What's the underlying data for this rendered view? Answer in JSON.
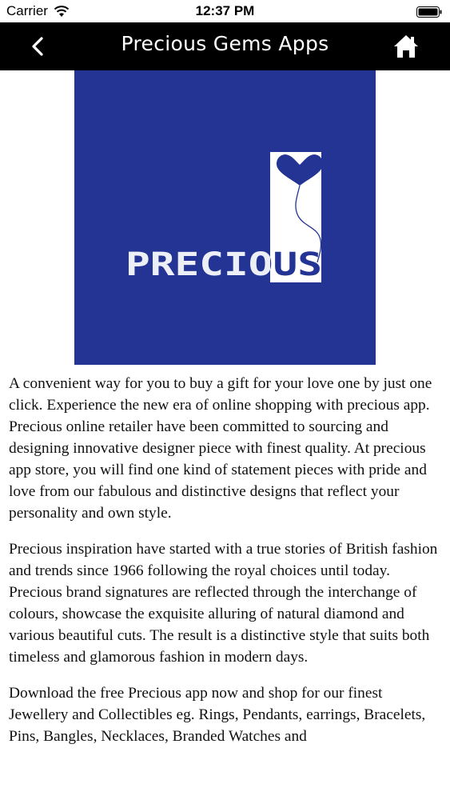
{
  "status_bar": {
    "carrier": "Carrier",
    "time": "12:37 PM"
  },
  "nav": {
    "title": "Precious Gems Apps",
    "back_icon": "chevron-left-icon",
    "home_icon": "home-icon"
  },
  "logo": {
    "wordmark": "PRECIOUS",
    "background_color": "#233494"
  },
  "content": {
    "paragraphs": [
      "A convenient way for you to buy a gift for your love one by just one click. Experience the new era of online shopping with precious app. Precious online retailer have been committed to sourcing and designing innovative designer piece with finest quality. At precious app store, you will find one kind of statement pieces with pride and love from our fabulous and distinctive designs that reflect your personality and own style.",
      "Precious inspiration have started with a true stories of British fashion and trends since 1966 following the royal choices until today. Precious brand signatures are reflected through the interchange of colours, showcase the exquisite alluring of natural diamond and various beautiful cuts. The result is a distinctive style that suits both timeless and glamorous fashion in modern days.",
      "Download the free Precious app now and shop for our finest Jewellery and Collectibles eg. Rings, Pendants, earrings, Bracelets, Pins, Bangles, Necklaces, Branded Watches and"
    ]
  }
}
